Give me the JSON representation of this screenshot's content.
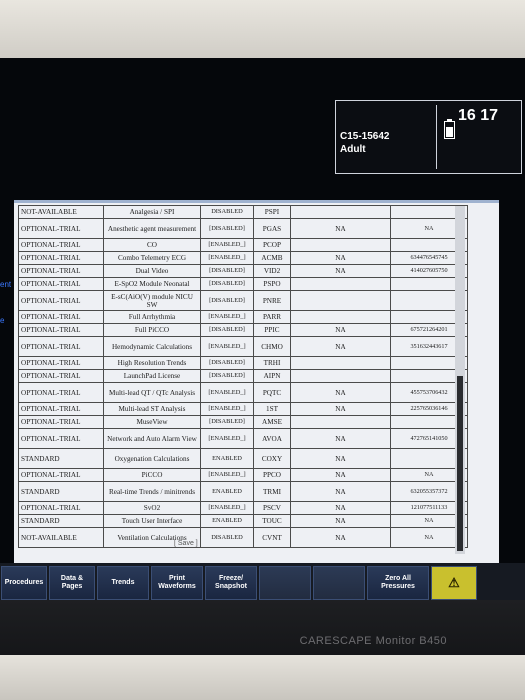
{
  "header": {
    "bed_label": "C15-15642",
    "patient_type": "Adult",
    "clock": "16 17"
  },
  "side_labels": [
    "ent",
    "e"
  ],
  "license_table": {
    "rows": [
      [
        "NOT-AVAILABLE",
        "Analgesia / SPI",
        "DISABLED",
        "PSPI",
        "",
        ""
      ],
      [
        "OPTIONAL-TRIAL",
        "Anesthetic agent measurement",
        "[DISABLED]",
        "PGAS",
        "NA",
        "NA"
      ],
      [
        "OPTIONAL-TRIAL",
        "CO",
        "[ENABLED_]",
        "PCOP",
        "",
        ""
      ],
      [
        "OPTIONAL-TRIAL",
        "Combo Telemetry ECG",
        "[ENABLED_]",
        "ACMB",
        "NA",
        "634476545745"
      ],
      [
        "OPTIONAL-TRIAL",
        "Dual Video",
        "[DISABLED]",
        "VID2",
        "NA",
        "414027605750"
      ],
      [
        "OPTIONAL-TRIAL",
        "E-SpO2 Module Neonatal",
        "[DISABLED]",
        "PSPO",
        "",
        ""
      ],
      [
        "OPTIONAL-TRIAL",
        "E-sC(AiO(V) module NICU SW",
        "[DISABLED]",
        "PNRE",
        "",
        ""
      ],
      [
        "OPTIONAL-TRIAL",
        "Full Arrhythmia",
        "[ENABLED_]",
        "PARR",
        "",
        ""
      ],
      [
        "OPTIONAL-TRIAL",
        "Full PiCCO",
        "[DISABLED]",
        "PPIC",
        "NA",
        "675721264201"
      ],
      [
        "OPTIONAL-TRIAL",
        "Hemodynamic Calculations",
        "[ENABLED_]",
        "CHMO",
        "NA",
        "351632443617"
      ],
      [
        "OPTIONAL-TRIAL",
        "High Resolution Trends",
        "[DISABLED]",
        "TRHI",
        "",
        ""
      ],
      [
        "OPTIONAL-TRIAL",
        "LaunchPad License",
        "[DISABLED]",
        "AIPN",
        "",
        ""
      ],
      [
        "OPTIONAL-TRIAL",
        "Multi-lead QT / QTc Analysis",
        "[ENABLED_]",
        "PQTC",
        "NA",
        "455753706432"
      ],
      [
        "OPTIONAL-TRIAL",
        "Multi-lead ST Analysis",
        "[ENABLED_]",
        "1ST",
        "NA",
        "225765036146"
      ],
      [
        "OPTIONAL-TRIAL",
        "MuseView",
        "[DISABLED]",
        "AMSE",
        "",
        ""
      ],
      [
        "OPTIONAL-TRIAL",
        "Network and Auto Alarm View",
        "[ENABLED_]",
        "AVOA",
        "NA",
        "472765141050"
      ],
      [
        "STANDARD",
        "Oxygenation Calculations",
        "ENABLED",
        "COXY",
        "NA",
        ""
      ],
      [
        "OPTIONAL-TRIAL",
        "PiCCO",
        "[ENABLED_]",
        "PPCO",
        "NA",
        "NA"
      ],
      [
        "STANDARD",
        "Real-time Trends / minitrends",
        "ENABLED",
        "TRMI",
        "NA",
        "632055357372"
      ],
      [
        "OPTIONAL-TRIAL",
        "SvO2",
        "[ENABLED_]",
        "PSCV",
        "NA",
        "121077511133"
      ],
      [
        "STANDARD",
        "Touch User Interface",
        "ENABLED",
        "TOUC",
        "NA",
        "NA"
      ],
      [
        "NOT-AVAILABLE",
        "Ventilation Calculations",
        "DISABLED",
        "CVNT",
        "NA",
        "NA"
      ]
    ],
    "save_label": "[ Save ]"
  },
  "softkeys": [
    "Procedures",
    "Data & Pages",
    "Trends",
    "Print Waveforms",
    "Freeze/ Snapshot",
    "",
    "",
    "Zero All Pressures",
    "⚠"
  ],
  "brand_text": "CARESCAPE Monitor B450"
}
